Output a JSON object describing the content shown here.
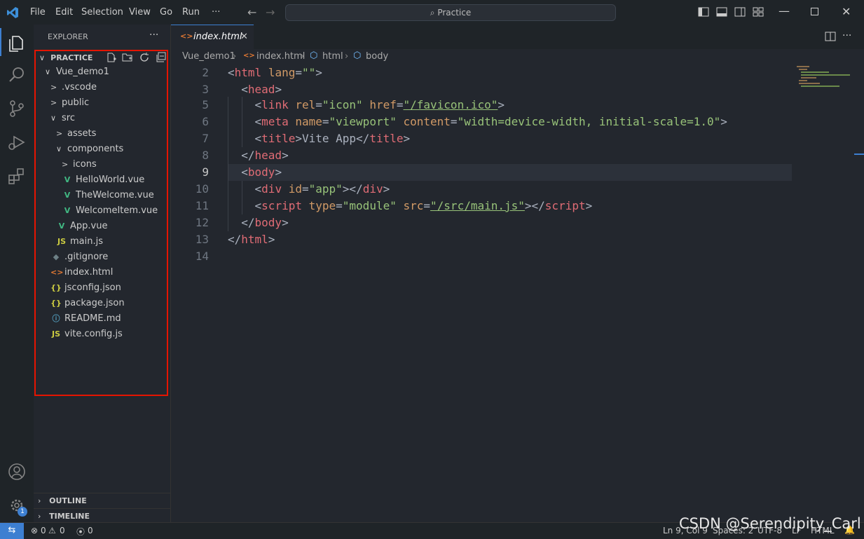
{
  "menu": [
    "File",
    "Edit",
    "Selection",
    "View",
    "Go",
    "Run",
    "···"
  ],
  "search_text": "Practice",
  "explorer": {
    "title": "EXPLORER",
    "more": "···",
    "section": "PRACTICE",
    "tree": [
      {
        "label": "Vue_demo1",
        "chev": "∨",
        "icon": "",
        "indent": 0,
        "name": "folder-vue-demo1"
      },
      {
        "label": ".vscode",
        "chev": ">",
        "icon": "",
        "indent": 1,
        "name": "folder-vscode"
      },
      {
        "label": "public",
        "chev": ">",
        "icon": "",
        "indent": 1,
        "name": "folder-public"
      },
      {
        "label": "src",
        "chev": "∨",
        "icon": "",
        "indent": 1,
        "name": "folder-src"
      },
      {
        "label": "assets",
        "chev": ">",
        "icon": "",
        "indent": 2,
        "name": "folder-assets"
      },
      {
        "label": "components",
        "chev": "∨",
        "icon": "",
        "indent": 2,
        "name": "folder-components"
      },
      {
        "label": "icons",
        "chev": ">",
        "icon": "",
        "indent": 3,
        "name": "folder-icons"
      },
      {
        "label": "HelloWorld.vue",
        "chev": "",
        "icon": "V",
        "indent": 3,
        "name": "file-helloworld"
      },
      {
        "label": "TheWelcome.vue",
        "chev": "",
        "icon": "V",
        "indent": 3,
        "name": "file-thewelcome"
      },
      {
        "label": "WelcomeItem.vue",
        "chev": "",
        "icon": "V",
        "indent": 3,
        "name": "file-welcomeitem"
      },
      {
        "label": "App.vue",
        "chev": "",
        "icon": "V",
        "indent": 2,
        "name": "file-app-vue"
      },
      {
        "label": "main.js",
        "chev": "",
        "icon": "JS",
        "indent": 2,
        "name": "file-main-js"
      },
      {
        "label": ".gitignore",
        "chev": "",
        "icon": "◆",
        "indent": 1,
        "name": "file-gitignore"
      },
      {
        "label": "index.html",
        "chev": "",
        "icon": "<>",
        "indent": 1,
        "name": "file-index-html"
      },
      {
        "label": "jsconfig.json",
        "chev": "",
        "icon": "{}",
        "indent": 1,
        "name": "file-jsconfig"
      },
      {
        "label": "package.json",
        "chev": "",
        "icon": "{}",
        "indent": 1,
        "name": "file-package"
      },
      {
        "label": "README.md",
        "chev": "",
        "icon": "ⓘ",
        "indent": 1,
        "name": "file-readme"
      },
      {
        "label": "vite.config.js",
        "chev": "",
        "icon": "JS",
        "indent": 1,
        "name": "file-vite-config"
      }
    ],
    "outline": "OUTLINE",
    "timeline": "TIMELINE"
  },
  "tab": {
    "label": "index.html",
    "close": "✕"
  },
  "breadcrumbs": [
    "Vue_demo1",
    "index.html",
    "html",
    "body"
  ],
  "code": [
    {
      "n": "2"
    },
    {
      "n": "3"
    },
    {
      "n": "5"
    },
    {
      "n": "6"
    },
    {
      "n": "7"
    },
    {
      "n": "8"
    },
    {
      "n": "9"
    },
    {
      "n": "10"
    },
    {
      "n": "11"
    },
    {
      "n": "12"
    },
    {
      "n": "13"
    },
    {
      "n": "14"
    }
  ],
  "code_text": {
    "html_tag": "html",
    "lang_attr": "lang",
    "lang_val": "\"\"",
    "head_tag": "head",
    "link_tag": "link",
    "rel_attr": "rel",
    "rel_val": "\"icon\"",
    "href_attr": "href",
    "href_val": "\"/favicon.ico\"",
    "meta_tag": "meta",
    "name_attr": "name",
    "name_val": "\"viewport\"",
    "content_attr": "content",
    "content_val": "\"width=device-width, initial-scale=1.0\"",
    "title_tag": "title",
    "title_text": "Vite App",
    "body_tag": "body",
    "div_tag": "div",
    "id_attr": "id",
    "id_val": "\"app\"",
    "script_tag": "script",
    "type_attr": "type",
    "type_val": "\"module\"",
    "src_attr": "src",
    "src_val": "\"/src/main.js\""
  },
  "status": {
    "errors": "0",
    "warnings": "0",
    "ports": "0",
    "cursor": "Ln 9, Col 9",
    "spaces": "Spaces: 2",
    "encoding": "UTF-8",
    "eol": "LF",
    "language": "HTML",
    "watermark": "CSDN @Serendipity_Carl"
  },
  "badge": "1",
  "colors": {
    "accent": "#3d7fd1",
    "highlight_box": "#e51400",
    "vue": "#41b883",
    "js": "#cbcb41",
    "html": "#e37933"
  }
}
